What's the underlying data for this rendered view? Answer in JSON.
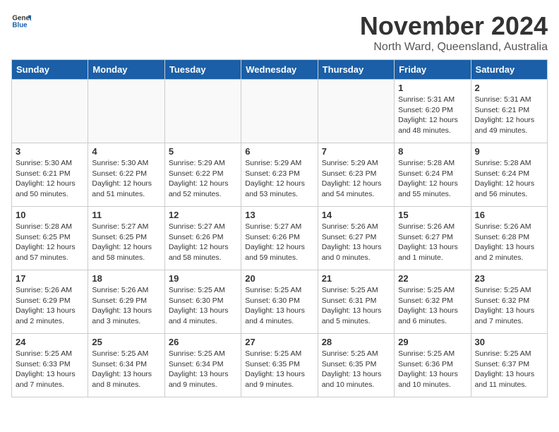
{
  "logo": {
    "general": "General",
    "blue": "Blue"
  },
  "header": {
    "month": "November 2024",
    "location": "North Ward, Queensland, Australia"
  },
  "weekdays": [
    "Sunday",
    "Monday",
    "Tuesday",
    "Wednesday",
    "Thursday",
    "Friday",
    "Saturday"
  ],
  "weeks": [
    [
      {
        "day": "",
        "empty": true
      },
      {
        "day": "",
        "empty": true
      },
      {
        "day": "",
        "empty": true
      },
      {
        "day": "",
        "empty": true
      },
      {
        "day": "",
        "empty": true
      },
      {
        "day": "1",
        "sunrise": "Sunrise: 5:31 AM",
        "sunset": "Sunset: 6:20 PM",
        "daylight": "Daylight: 12 hours and 48 minutes."
      },
      {
        "day": "2",
        "sunrise": "Sunrise: 5:31 AM",
        "sunset": "Sunset: 6:21 PM",
        "daylight": "Daylight: 12 hours and 49 minutes."
      }
    ],
    [
      {
        "day": "3",
        "sunrise": "Sunrise: 5:30 AM",
        "sunset": "Sunset: 6:21 PM",
        "daylight": "Daylight: 12 hours and 50 minutes."
      },
      {
        "day": "4",
        "sunrise": "Sunrise: 5:30 AM",
        "sunset": "Sunset: 6:22 PM",
        "daylight": "Daylight: 12 hours and 51 minutes."
      },
      {
        "day": "5",
        "sunrise": "Sunrise: 5:29 AM",
        "sunset": "Sunset: 6:22 PM",
        "daylight": "Daylight: 12 hours and 52 minutes."
      },
      {
        "day": "6",
        "sunrise": "Sunrise: 5:29 AM",
        "sunset": "Sunset: 6:23 PM",
        "daylight": "Daylight: 12 hours and 53 minutes."
      },
      {
        "day": "7",
        "sunrise": "Sunrise: 5:29 AM",
        "sunset": "Sunset: 6:23 PM",
        "daylight": "Daylight: 12 hours and 54 minutes."
      },
      {
        "day": "8",
        "sunrise": "Sunrise: 5:28 AM",
        "sunset": "Sunset: 6:24 PM",
        "daylight": "Daylight: 12 hours and 55 minutes."
      },
      {
        "day": "9",
        "sunrise": "Sunrise: 5:28 AM",
        "sunset": "Sunset: 6:24 PM",
        "daylight": "Daylight: 12 hours and 56 minutes."
      }
    ],
    [
      {
        "day": "10",
        "sunrise": "Sunrise: 5:28 AM",
        "sunset": "Sunset: 6:25 PM",
        "daylight": "Daylight: 12 hours and 57 minutes."
      },
      {
        "day": "11",
        "sunrise": "Sunrise: 5:27 AM",
        "sunset": "Sunset: 6:25 PM",
        "daylight": "Daylight: 12 hours and 58 minutes."
      },
      {
        "day": "12",
        "sunrise": "Sunrise: 5:27 AM",
        "sunset": "Sunset: 6:26 PM",
        "daylight": "Daylight: 12 hours and 58 minutes."
      },
      {
        "day": "13",
        "sunrise": "Sunrise: 5:27 AM",
        "sunset": "Sunset: 6:26 PM",
        "daylight": "Daylight: 12 hours and 59 minutes."
      },
      {
        "day": "14",
        "sunrise": "Sunrise: 5:26 AM",
        "sunset": "Sunset: 6:27 PM",
        "daylight": "Daylight: 13 hours and 0 minutes."
      },
      {
        "day": "15",
        "sunrise": "Sunrise: 5:26 AM",
        "sunset": "Sunset: 6:27 PM",
        "daylight": "Daylight: 13 hours and 1 minute."
      },
      {
        "day": "16",
        "sunrise": "Sunrise: 5:26 AM",
        "sunset": "Sunset: 6:28 PM",
        "daylight": "Daylight: 13 hours and 2 minutes."
      }
    ],
    [
      {
        "day": "17",
        "sunrise": "Sunrise: 5:26 AM",
        "sunset": "Sunset: 6:29 PM",
        "daylight": "Daylight: 13 hours and 2 minutes."
      },
      {
        "day": "18",
        "sunrise": "Sunrise: 5:26 AM",
        "sunset": "Sunset: 6:29 PM",
        "daylight": "Daylight: 13 hours and 3 minutes."
      },
      {
        "day": "19",
        "sunrise": "Sunrise: 5:25 AM",
        "sunset": "Sunset: 6:30 PM",
        "daylight": "Daylight: 13 hours and 4 minutes."
      },
      {
        "day": "20",
        "sunrise": "Sunrise: 5:25 AM",
        "sunset": "Sunset: 6:30 PM",
        "daylight": "Daylight: 13 hours and 4 minutes."
      },
      {
        "day": "21",
        "sunrise": "Sunrise: 5:25 AM",
        "sunset": "Sunset: 6:31 PM",
        "daylight": "Daylight: 13 hours and 5 minutes."
      },
      {
        "day": "22",
        "sunrise": "Sunrise: 5:25 AM",
        "sunset": "Sunset: 6:32 PM",
        "daylight": "Daylight: 13 hours and 6 minutes."
      },
      {
        "day": "23",
        "sunrise": "Sunrise: 5:25 AM",
        "sunset": "Sunset: 6:32 PM",
        "daylight": "Daylight: 13 hours and 7 minutes."
      }
    ],
    [
      {
        "day": "24",
        "sunrise": "Sunrise: 5:25 AM",
        "sunset": "Sunset: 6:33 PM",
        "daylight": "Daylight: 13 hours and 7 minutes."
      },
      {
        "day": "25",
        "sunrise": "Sunrise: 5:25 AM",
        "sunset": "Sunset: 6:34 PM",
        "daylight": "Daylight: 13 hours and 8 minutes."
      },
      {
        "day": "26",
        "sunrise": "Sunrise: 5:25 AM",
        "sunset": "Sunset: 6:34 PM",
        "daylight": "Daylight: 13 hours and 9 minutes."
      },
      {
        "day": "27",
        "sunrise": "Sunrise: 5:25 AM",
        "sunset": "Sunset: 6:35 PM",
        "daylight": "Daylight: 13 hours and 9 minutes."
      },
      {
        "day": "28",
        "sunrise": "Sunrise: 5:25 AM",
        "sunset": "Sunset: 6:35 PM",
        "daylight": "Daylight: 13 hours and 10 minutes."
      },
      {
        "day": "29",
        "sunrise": "Sunrise: 5:25 AM",
        "sunset": "Sunset: 6:36 PM",
        "daylight": "Daylight: 13 hours and 10 minutes."
      },
      {
        "day": "30",
        "sunrise": "Sunrise: 5:25 AM",
        "sunset": "Sunset: 6:37 PM",
        "daylight": "Daylight: 13 hours and 11 minutes."
      }
    ]
  ]
}
